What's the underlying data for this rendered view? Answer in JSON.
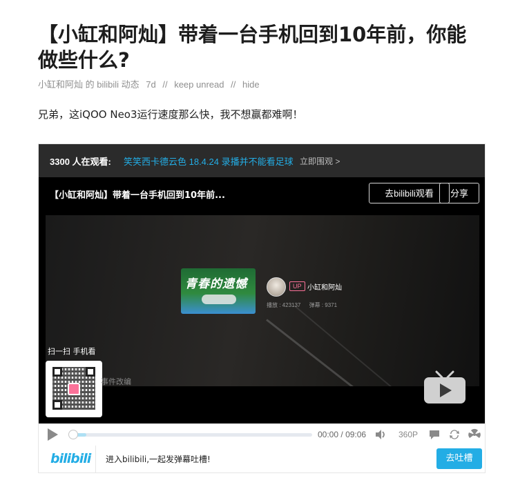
{
  "post": {
    "title": "【小缸和阿灿】带着一台手机回到10年前，你能做些什么?",
    "meta": {
      "source": "小缸和阿灿 的 bilibili 动态",
      "age": "7d",
      "sep": "//",
      "keep_unread": "keep unread",
      "hide": "hide"
    },
    "body": "兄弟，这iQOO Neo3运行速度那么快，我不想赢都难啊！"
  },
  "player": {
    "viewers": "3300 人在观看:",
    "live_link": "笑笑西卡德云色 18.4.24 录播并不能看足球",
    "watch_link": "立即围观 >",
    "video_title": "【小缸和阿灿】带着一台手机回到10年前...",
    "goto_button": "去bilibili观看",
    "share_button": "分享",
    "end_card": {
      "thumb_text": "青春的遗憾",
      "badge": "UP",
      "uploader": "小缸和阿灿",
      "plays": "播放 : 423137",
      "danmaku": "弹幕 : 9371"
    },
    "scan_label": "扫一扫 手机看",
    "overlay_caption": "事件改编",
    "controls": {
      "current_time": "00:00",
      "time_sep": "/",
      "duration": "09:06",
      "quality": "360P",
      "buffered": 0.07,
      "played": 0.0
    },
    "danmaku_bar": {
      "logo": "bilibili",
      "placeholder": "进入bilibili,一起发弹幕吐槽!",
      "send_button": "去吐槽"
    }
  },
  "colors": {
    "accent": "#23ade5",
    "up_pink": "#fb7299",
    "topbar": "#2b2b2b"
  }
}
